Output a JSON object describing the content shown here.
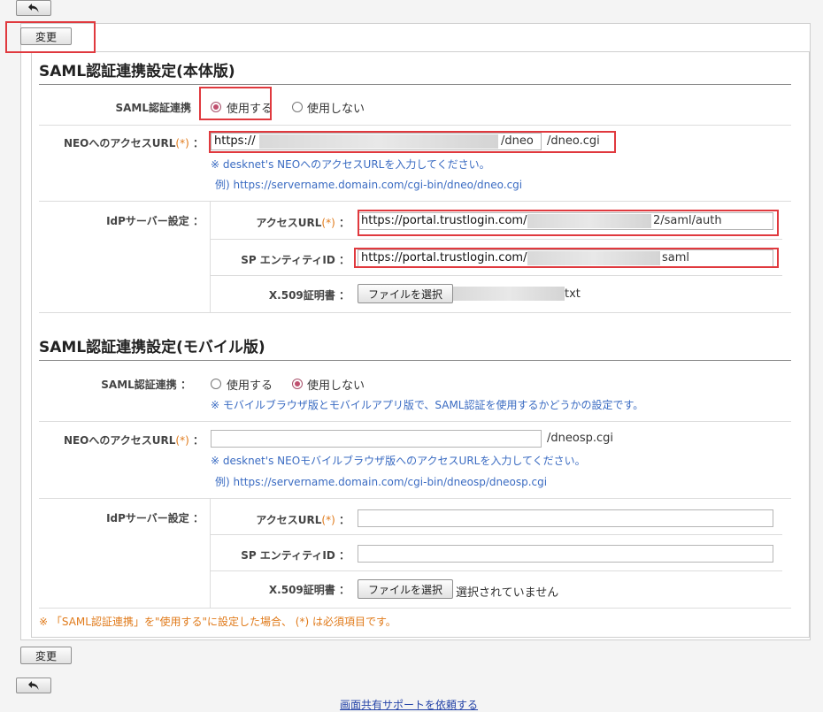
{
  "toolbar": {
    "change_label": "変更"
  },
  "main": {
    "title": "SAML認証連携設定(本体版)",
    "saml_label": "SAML認証連携",
    "radio_use": "使用する",
    "radio_nouse": "使用しない",
    "saml_value": "use",
    "neo_url_label": "NEOへのアクセスURL",
    "req_mark": "(*)",
    "colon": "：",
    "neo_url_prefix": "https://",
    "neo_url_mid": "/dneo",
    "neo_url_suffix": "/dneo.cgi",
    "neo_url_note": "※ desknet's NEOへのアクセスURLを入力してください。",
    "neo_url_example": "例) https://servername.domain.com/cgi-bin/dneo/dneo.cgi",
    "idp_label": "IdPサーバー設定",
    "access_url_label": "アクセスURL",
    "access_url_prefix": "https://portal.trustlogin.com/",
    "access_url_suffix": "2/saml/auth",
    "sp_entity_label": "SP エンティティID",
    "sp_entity_prefix": "https://portal.trustlogin.com/",
    "sp_entity_suffix": "saml",
    "x509_label": "X.509証明書",
    "file_button": "ファイルを選択",
    "file_name_suffix": "txt"
  },
  "mobile": {
    "title": "SAML認証連携設定(モバイル版)",
    "saml_label": "SAML認証連携",
    "radio_use": "使用する",
    "radio_nouse": "使用しない",
    "saml_value": "nouse",
    "saml_note": "※ モバイルブラウザ版とモバイルアプリ版で、SAML認証を使用するかどうかの設定です。",
    "neo_url_label": "NEOへのアクセスURL",
    "neo_url_value": "",
    "neo_url_suffix": "/dneosp.cgi",
    "neo_url_note": "※ desknet's NEOモバイルブラウザ版へのアクセスURLを入力してください。",
    "neo_url_example": "例) https://servername.domain.com/cgi-bin/dneosp/dneosp.cgi",
    "idp_label": "IdPサーバー設定",
    "access_url_label": "アクセスURL",
    "access_url_value": "",
    "sp_entity_label": "SP エンティティID",
    "sp_entity_value": "",
    "x509_label": "X.509証明書",
    "file_button": "ファイルを選択",
    "file_none": "選択されていません"
  },
  "footer_note": "※ 「SAML認証連携」を\"使用する\"に設定した場合、 (*) は必須項目です。",
  "footer_link": "画面共有サポートを依頼する",
  "icons": {
    "back": "back-arrow-icon",
    "radio": "radio-icon"
  },
  "colors": {
    "highlight": "#e0393e",
    "required": "#e07a1a",
    "note": "#3a6bc2",
    "radio_selected": "#c0506f"
  }
}
